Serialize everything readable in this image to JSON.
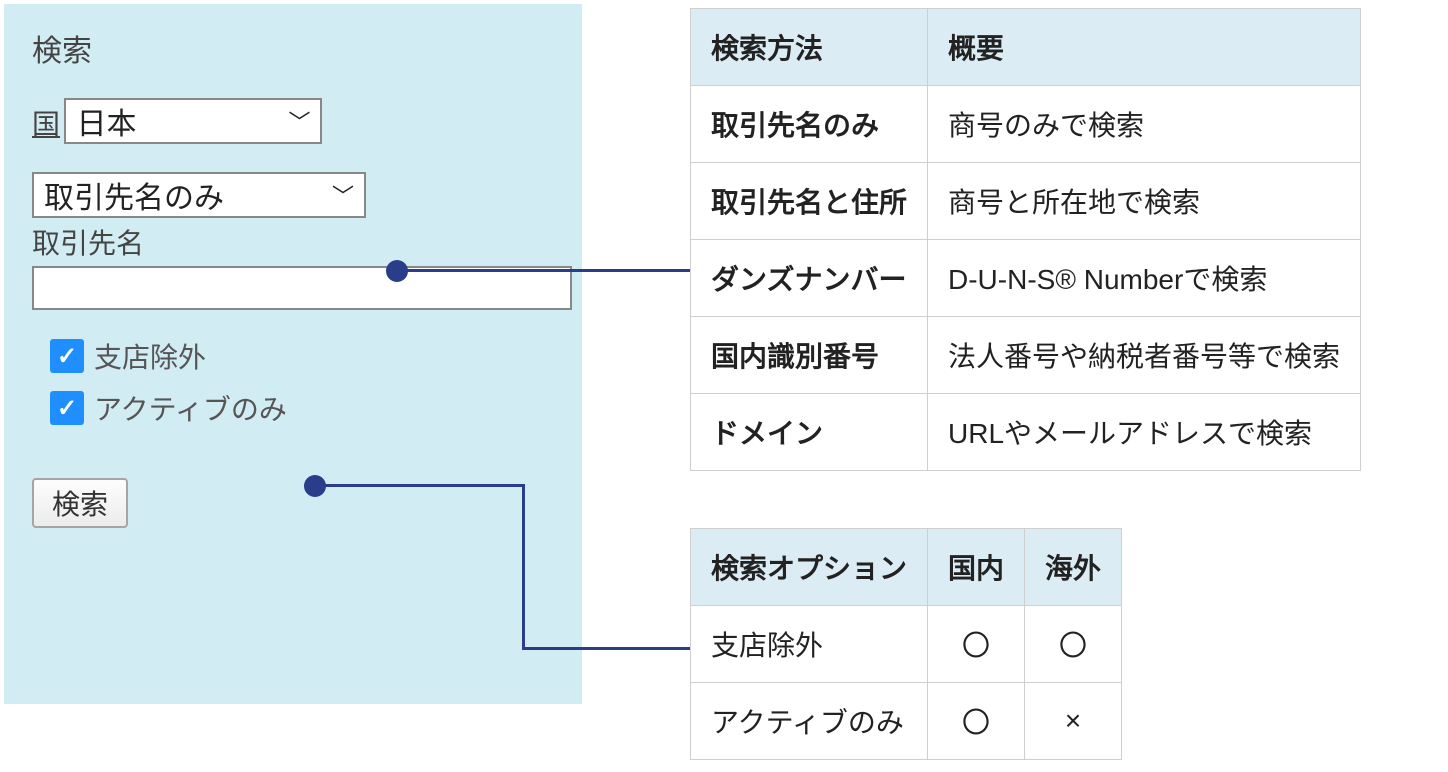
{
  "panel": {
    "title": "検索",
    "country_label": "国",
    "country_value": "日本",
    "method_value": "取引先名のみ",
    "name_label": "取引先名",
    "name_value": "",
    "exclude_branch_label": "支店除外",
    "active_only_label": "アクティブのみ",
    "search_button": "検索"
  },
  "method_table": {
    "headers": {
      "method": "検索方法",
      "desc": "概要"
    },
    "rows": [
      {
        "method": "取引先名のみ",
        "desc": "商号のみで検索"
      },
      {
        "method": "取引先名と住所",
        "desc": "商号と所在地で検索"
      },
      {
        "method": "ダンズナンバー",
        "desc": "D-U-N-S® Numberで検索"
      },
      {
        "method": "国内識別番号",
        "desc": "法人番号や納税者番号等で検索"
      },
      {
        "method": "ドメイン",
        "desc": "URLやメールアドレスで検索"
      }
    ]
  },
  "option_table": {
    "headers": {
      "option": "検索オプション",
      "domestic": "国内",
      "overseas": "海外"
    },
    "rows": [
      {
        "option": "支店除外",
        "domestic": "〇",
        "overseas": "〇"
      },
      {
        "option": "アクティブのみ",
        "domestic": "〇",
        "overseas": "×"
      }
    ]
  }
}
